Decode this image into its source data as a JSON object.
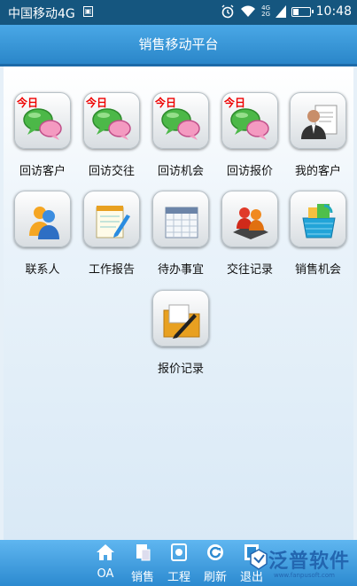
{
  "status_bar": {
    "carrier": "中国移动4G",
    "time": "10:48",
    "signal_label_top": "4G",
    "signal_label_bottom": "2G"
  },
  "header": {
    "title": "销售移动平台"
  },
  "badge_text": "今日",
  "tiles": [
    {
      "label": "回访客户",
      "icon": "chat-bubbles-icon",
      "badge": true
    },
    {
      "label": "回访交往",
      "icon": "chat-bubbles-icon",
      "badge": true
    },
    {
      "label": "回访机会",
      "icon": "chat-bubbles-icon",
      "badge": true
    },
    {
      "label": "回访报价",
      "icon": "chat-bubbles-icon",
      "badge": true
    },
    {
      "label": "我的客户",
      "icon": "person-document-icon",
      "badge": false
    },
    {
      "label": "联系人",
      "icon": "people-icon",
      "badge": false
    },
    {
      "label": "工作报告",
      "icon": "notepad-pencil-icon",
      "badge": false
    },
    {
      "label": "待办事宜",
      "icon": "calendar-icon",
      "badge": false
    },
    {
      "label": "交往记录",
      "icon": "people-book-icon",
      "badge": false
    },
    {
      "label": "销售机会",
      "icon": "basket-icon",
      "badge": false
    },
    {
      "label": "报价记录",
      "icon": "folder-pen-icon",
      "badge": false
    }
  ],
  "bottom_nav": [
    {
      "label": "OA",
      "icon": "home-icon"
    },
    {
      "label": "销售",
      "icon": "sales-icon"
    },
    {
      "label": "工程",
      "icon": "engineering-icon"
    },
    {
      "label": "刷新",
      "icon": "refresh-icon"
    },
    {
      "label": "退出",
      "icon": "exit-icon"
    }
  ],
  "brand": {
    "name": "泛普软件",
    "url_text": "www.fanpusoft.com"
  },
  "colors": {
    "status_bar": "#15567f",
    "header": "#2a86c9",
    "bottom_bar": "#2c8ad0",
    "badge": "#ee0000"
  }
}
